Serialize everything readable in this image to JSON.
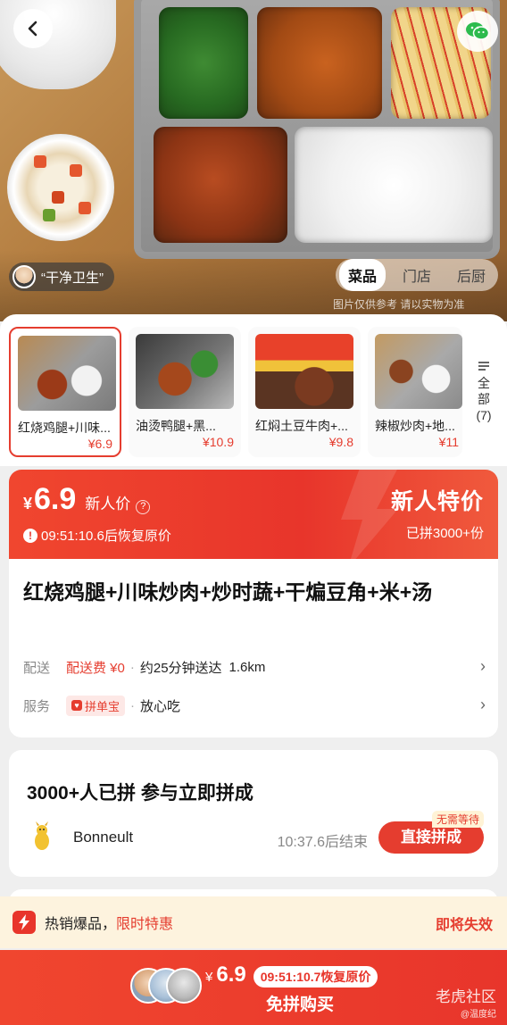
{
  "hero": {
    "hygiene_label": "“干净卫生”",
    "photo_tabs": [
      "菜品",
      "门店",
      "后厨"
    ],
    "photo_note": "图片仅供参考 请以实物为准"
  },
  "dishes": [
    {
      "name": "红烧鸡腿+川味...",
      "price": "¥6.9"
    },
    {
      "name": "油烫鸭腿+黑...",
      "price": "¥10.9"
    },
    {
      "name": "红焖土豆牛肉+...",
      "price": "¥9.8"
    },
    {
      "name": "辣椒炒肉+地...",
      "price": "¥11"
    }
  ],
  "all_dishes": {
    "label": "全部",
    "count": "(7)"
  },
  "banner": {
    "currency": "¥",
    "price": "6.9",
    "price_label": "新人价",
    "countdown": "09:51:10.6后恢复原价",
    "special": "新人特价",
    "joined": "已拼3000+份"
  },
  "product": {
    "title": "红烧鸡腿+川味炒肉+炒时蔬+干煸豆角+米+汤",
    "delivery_label": "配送",
    "delivery_fee": "配送费 ¥0",
    "delivery_time": "约25分钟送达",
    "distance": "1.6km",
    "service_label": "服务",
    "service_tag": "拼单宝",
    "service_text": "放心吃"
  },
  "group": {
    "title": "3000+人已拼 参与立即拼成",
    "user_name": "Bonneult",
    "ends": "10:37.6后结束",
    "join_label": "直接拼成",
    "no_wait": "无需等待"
  },
  "hot": {
    "text": "热销爆品，",
    "highlight": "限时特惠",
    "expire": "即将失效"
  },
  "bottom": {
    "currency": "¥",
    "price": "6.9",
    "countdown": "09:51:10.7恢复原价",
    "buy_label": "免拼购买",
    "watermark": "老虎社区",
    "watermark_sub": "@温度纪"
  },
  "colors": {
    "accent": "#e53d2f",
    "banner": "#e8352b",
    "hot_bg": "#fdf3de"
  }
}
